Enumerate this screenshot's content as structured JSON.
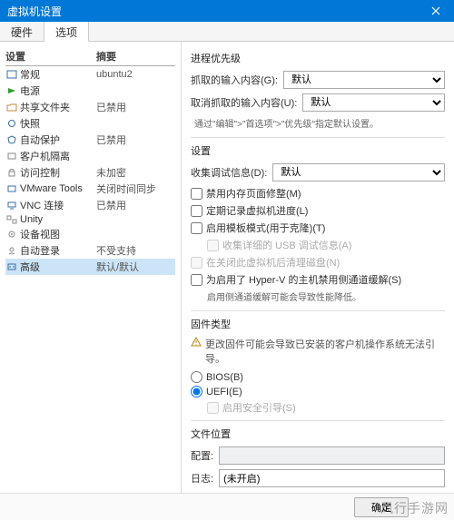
{
  "window": {
    "title": "虚拟机设置"
  },
  "tabs": {
    "hardware": "硬件",
    "options": "选项"
  },
  "left": {
    "header_setting": "设置",
    "header_summary": "摘要",
    "rows": [
      {
        "name": "常规",
        "summary": "ubuntu2"
      },
      {
        "name": "电源",
        "summary": ""
      },
      {
        "name": "共享文件夹",
        "summary": "已禁用"
      },
      {
        "name": "快照",
        "summary": ""
      },
      {
        "name": "自动保护",
        "summary": "已禁用"
      },
      {
        "name": "客户机隔离",
        "summary": ""
      },
      {
        "name": "访问控制",
        "summary": "未加密"
      },
      {
        "name": "VMware Tools",
        "summary": "关闭时间同步"
      },
      {
        "name": "VNC 连接",
        "summary": "已禁用"
      },
      {
        "name": "Unity",
        "summary": ""
      },
      {
        "name": "设备视图",
        "summary": ""
      },
      {
        "name": "自动登录",
        "summary": "不受支持"
      },
      {
        "name": "高级",
        "summary": "默认/默认"
      }
    ]
  },
  "right": {
    "process_priority": {
      "title": "进程优先级",
      "grabbed_label": "抓取的输入内容(G):",
      "ungrabbed_label": "取消抓取的输入内容(U):",
      "default_option": "默认",
      "hint": "通过\"编辑\">\"首选项\">\"优先级\"指定默认设置。"
    },
    "settings": {
      "title": "设置",
      "debug_label": "收集调试信息(D):",
      "default_option": "默认",
      "cb_mem_trim": "禁用内存页面修整(M)",
      "cb_log_progress": "定期记录虚拟机进度(L)",
      "cb_template": "启用模板模式(用于克隆)(T)",
      "cb_usb_debug": "收集详细的 USB 调试信息(A)",
      "cb_clean_disk": "在关闭此虚拟机后清理磁盘(N)",
      "cb_hyperv": "为启用了 Hyper-V 的主机禁用侧通道缓解(S)",
      "hyperv_hint": "启用侧通道缓解可能会导致性能降低。"
    },
    "firmware": {
      "title": "固件类型",
      "warning": "更改固件可能会导致已安装的客户机操作系统无法引导。",
      "bios": "BIOS(B)",
      "uefi": "UEFI(E)",
      "secure_boot": "启用安全引导(S)"
    },
    "file_location": {
      "title": "文件位置",
      "config_label": "配置:",
      "log_label": "日志:",
      "log_value": "(未开启)"
    }
  },
  "footer": {
    "ok": "确定"
  },
  "watermark": "风行手游网"
}
